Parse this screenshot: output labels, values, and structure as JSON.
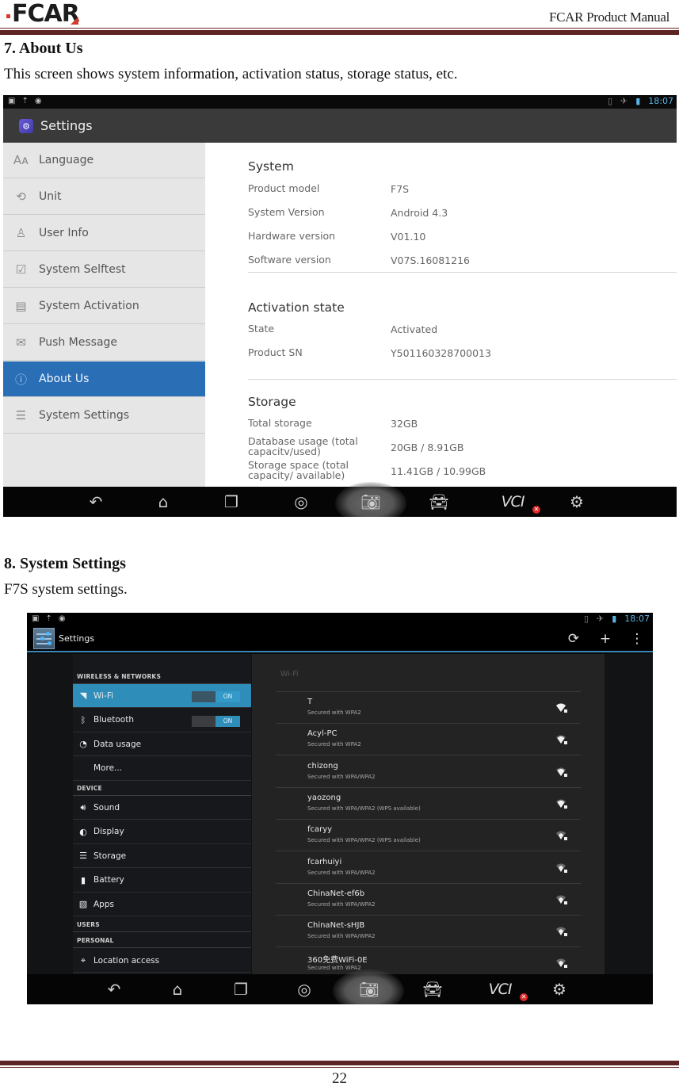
{
  "header": {
    "logo_text": "FCAR",
    "manual_title": "FCAR Product Manual"
  },
  "section7": {
    "heading": "7. About Us",
    "description": "This screen shows system information, activation status, storage status, etc."
  },
  "about_screen": {
    "status_bar": {
      "time": "18:07",
      "left_icons": [
        "picture-icon",
        "upload-icon",
        "android-icon"
      ],
      "right_icons": [
        "vibrate-icon",
        "airplane-icon",
        "battery-icon"
      ]
    },
    "app_bar_title": "Settings",
    "sidebar": [
      {
        "label": "Language",
        "icon": "language-icon",
        "glyph": "Aᴀ",
        "active": false
      },
      {
        "label": "Unit",
        "icon": "unit-convert-icon",
        "glyph": "⟲",
        "active": false
      },
      {
        "label": "User Info",
        "icon": "user-icon",
        "glyph": "♙",
        "active": false
      },
      {
        "label": "System Selftest",
        "icon": "selftest-icon",
        "glyph": "☑",
        "active": false
      },
      {
        "label": "System Activation",
        "icon": "activation-icon",
        "glyph": "▤",
        "active": false
      },
      {
        "label": "Push Message",
        "icon": "message-icon",
        "glyph": "✉",
        "active": false
      },
      {
        "label": "About Us",
        "icon": "info-icon",
        "glyph": "ⓘ",
        "active": true
      },
      {
        "label": "System Settings",
        "icon": "sliders-icon",
        "glyph": "☰",
        "active": false
      }
    ],
    "sections": {
      "system": {
        "title": "System",
        "rows": [
          {
            "key": "Product model",
            "value": "F7S"
          },
          {
            "key": "System Version",
            "value": "Android 4.3"
          },
          {
            "key": "Hardware version",
            "value": "V01.10"
          },
          {
            "key": "Software version",
            "value": "V07S.16081216"
          }
        ]
      },
      "activation": {
        "title": "Activation state",
        "rows": [
          {
            "key": "State",
            "value": "Activated"
          },
          {
            "key": "Product SN",
            "value": "Y501160328700013"
          }
        ]
      },
      "storage": {
        "title": "Storage",
        "rows": [
          {
            "key": "Total storage",
            "value": "32GB"
          },
          {
            "key": "Database usage (total capacitv/used)",
            "value": "20GB / 8.91GB"
          },
          {
            "key": "Storage space (total capacity/ available)",
            "value": "11.41GB / 10.99GB"
          }
        ]
      }
    }
  },
  "nav_bar": {
    "buttons": [
      {
        "name": "back-icon",
        "glyph": "↶"
      },
      {
        "name": "home-icon",
        "glyph": "⌂"
      },
      {
        "name": "recent-apps-icon",
        "glyph": "❐"
      },
      {
        "name": "browser-icon",
        "glyph": "◎"
      },
      {
        "name": "camera-icon",
        "glyph": "📷︎"
      },
      {
        "name": "car-icon",
        "glyph": "🚘︎"
      },
      {
        "name": "vci-icon",
        "glyph": "VCI"
      },
      {
        "name": "settings-gear-icon",
        "glyph": "⚙"
      }
    ],
    "vci_status": "✕"
  },
  "section8": {
    "heading": "8. System Settings",
    "description": "F7S system settings."
  },
  "settings_screen": {
    "status_bar": {
      "time": "18:07"
    },
    "app_bar_title": "Settings",
    "actions": [
      {
        "name": "sync-icon",
        "glyph": "⟳"
      },
      {
        "name": "add-icon",
        "glyph": "+"
      },
      {
        "name": "overflow-menu-icon",
        "glyph": "⋮"
      }
    ],
    "categories": {
      "wireless": "WIRELESS & NETWORKS",
      "device": "DEVICE",
      "users": "USERS",
      "personal": "PERSONAL"
    },
    "wireless_items": [
      {
        "label": "Wi-Fi",
        "icon": "wifi-icon",
        "glyph": "◥",
        "toggle": "ON",
        "active": true
      },
      {
        "label": "Bluetooth",
        "icon": "bluetooth-icon",
        "glyph": "ᛒ",
        "toggle": "ON",
        "active": false
      },
      {
        "label": "Data usage",
        "icon": "data-usage-icon",
        "glyph": "◔",
        "toggle": null,
        "active": false
      },
      {
        "label": "More...",
        "icon": null,
        "glyph": "",
        "toggle": null,
        "active": false
      }
    ],
    "device_items": [
      {
        "label": "Sound",
        "icon": "sound-icon",
        "glyph": "🔊︎"
      },
      {
        "label": "Display",
        "icon": "display-icon",
        "glyph": "◐"
      },
      {
        "label": "Storage",
        "icon": "storage-icon",
        "glyph": "☰"
      },
      {
        "label": "Battery",
        "icon": "battery-icon",
        "glyph": "▮"
      },
      {
        "label": "Apps",
        "icon": "apps-icon",
        "glyph": "▧"
      }
    ],
    "personal_items": [
      {
        "label": "Location access",
        "icon": "location-icon",
        "glyph": "⌖"
      }
    ],
    "wifi_panel": {
      "header": "Wi-Fi",
      "networks": [
        {
          "ssid": "T",
          "security": "Secured with WPA2",
          "signal": 4
        },
        {
          "ssid": "Acyl-PC",
          "security": "Secured with WPA2",
          "signal": 3
        },
        {
          "ssid": "chizong",
          "security": "Secured with WPA/WPA2",
          "signal": 3
        },
        {
          "ssid": "yaozong",
          "security": "Secured with WPA/WPA2 (WPS available)",
          "signal": 3
        },
        {
          "ssid": "fcaryy",
          "security": "Secured with WPA/WPA2 (WPS available)",
          "signal": 2
        },
        {
          "ssid": "fcarhuiyi",
          "security": "Secured with WPA/WPA2",
          "signal": 2
        },
        {
          "ssid": "ChinaNet-ef6b",
          "security": "Secured with WPA/WPA2",
          "signal": 2
        },
        {
          "ssid": "ChinaNet-sHJB",
          "security": "Secured with WPA/WPA2",
          "signal": 2
        },
        {
          "ssid": "360免费WiFi-0E",
          "security": "Secured with WPA2",
          "signal": 2
        }
      ]
    }
  },
  "footer": {
    "page_number": "22"
  }
}
